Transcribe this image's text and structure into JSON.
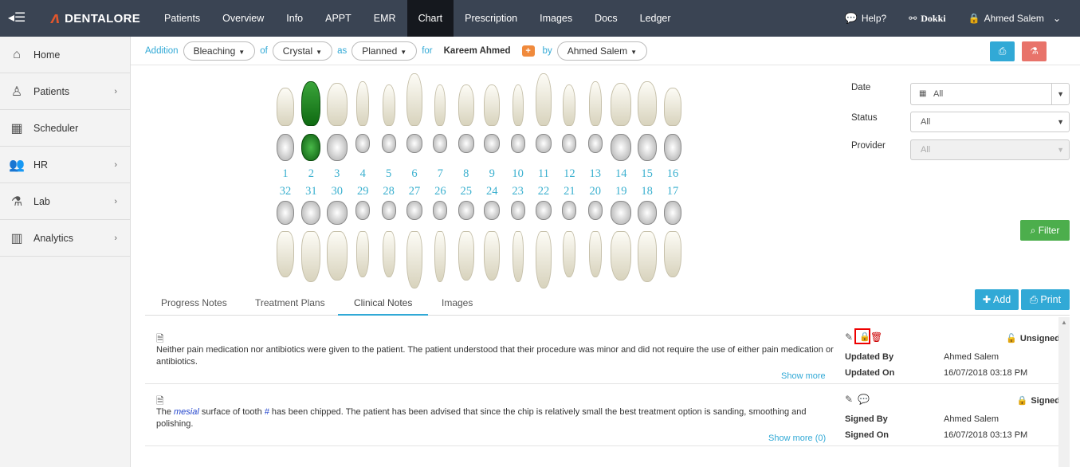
{
  "nav": {
    "brand": "DENTALORE",
    "tabs": [
      "Patients",
      "Overview",
      "Info",
      "APPT",
      "EMR",
      "Chart",
      "Prescription",
      "Images",
      "Docs",
      "Ledger"
    ],
    "active_tab": "Chart",
    "help": "Help?",
    "clinic": "Dokki",
    "user": "Ahmed Salem"
  },
  "sidebar": {
    "items": [
      {
        "label": "Home",
        "icon": "home-icon"
      },
      {
        "label": "Patients",
        "icon": "person-icon"
      },
      {
        "label": "Scheduler",
        "icon": "calendar-icon"
      },
      {
        "label": "HR",
        "icon": "users-icon"
      },
      {
        "label": "Lab",
        "icon": "flask-icon"
      },
      {
        "label": "Analytics",
        "icon": "bar-chart-icon"
      }
    ]
  },
  "addbar": {
    "addition": "Addition",
    "treatment": "Bleaching",
    "of": "of",
    "material": "Crystal",
    "as": "as",
    "status": "Planned",
    "for": "for",
    "patient": "Kareem Ahmed",
    "by": "by",
    "provider": "Ahmed Salem"
  },
  "teeth": {
    "upper_numbers": [
      "1",
      "2",
      "3",
      "4",
      "5",
      "6",
      "7",
      "8",
      "9",
      "10",
      "11",
      "12",
      "13",
      "14",
      "15",
      "16"
    ],
    "lower_numbers": [
      "32",
      "31",
      "30",
      "29",
      "28",
      "27",
      "26",
      "25",
      "24",
      "23",
      "22",
      "21",
      "20",
      "19",
      "18",
      "17"
    ],
    "highlighted": "2",
    "highlight_color": "#1f8a1f"
  },
  "filters": {
    "date_label": "Date",
    "date_value": "All",
    "status_label": "Status",
    "status_value": "All",
    "provider_label": "Provider",
    "provider_value": "All",
    "filter_button": "Filter"
  },
  "tabs": [
    "Progress Notes",
    "Treatment Plans",
    "Clinical Notes",
    "Images"
  ],
  "active_tab": "Clinical Notes",
  "add_button": "Add",
  "print_button": "Print",
  "notes": [
    {
      "text": "Neither pain medication nor antibiotics were given to the patient. The patient understood that their procedure was minor and did not require the use of either pain medication or antibiotics.",
      "more": "Show more",
      "status": "Unsigned",
      "by_label": "Updated By",
      "by": "Ahmed Salem",
      "on_label": "Updated On",
      "on": "16/07/2018 03:18 PM"
    },
    {
      "text_pre": "The ",
      "text_em1": "mesial",
      "text_mid": " surface of tooth ",
      "text_em2": "#",
      "text_post": " has been chipped. The patient has been advised that since the chip is relatively small the best treatment option is sanding, smoothing and polishing.",
      "more": "Show more (0)",
      "status": "Signed",
      "by_label": "Signed By",
      "by": "Ahmed Salem",
      "on_label": "Signed On",
      "on": "16/07/2018 03:13 PM"
    }
  ],
  "colors": {
    "accent": "#31a9d6",
    "nav": "#3a4453",
    "success": "#4cae4c",
    "danger": "#e8736a",
    "unsigned": "#e00000",
    "signed": "#1e7b1e"
  }
}
